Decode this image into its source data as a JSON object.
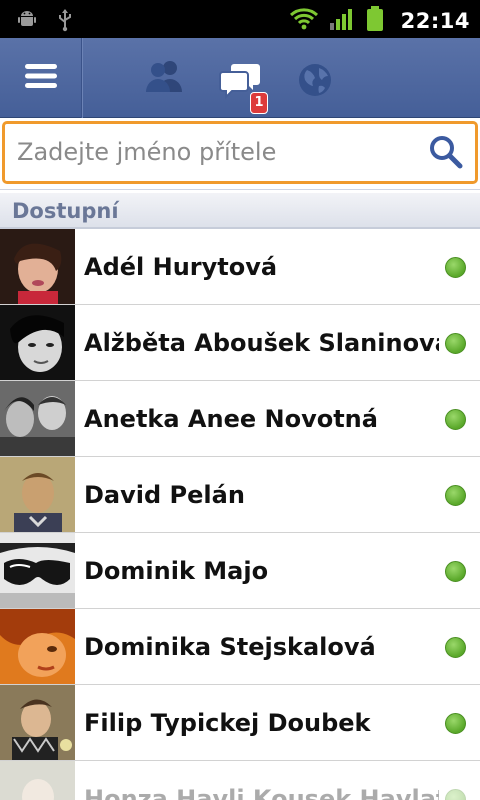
{
  "status_bar": {
    "time": "22:14",
    "icons": [
      "android-debug-icon",
      "usb-icon",
      "wifi-icon",
      "signal-icon",
      "battery-icon"
    ]
  },
  "navbar": {
    "menu_icon": "hamburger-menu-icon",
    "tabs": [
      {
        "icon": "friend-requests-icon"
      },
      {
        "icon": "messages-icon",
        "badge": "1"
      },
      {
        "icon": "notifications-globe-icon"
      }
    ]
  },
  "search": {
    "placeholder": "Zadejte jméno přítele",
    "value": ""
  },
  "section": {
    "title": "Dostupní"
  },
  "friends": [
    {
      "name": "Adél Hurytová",
      "online": true
    },
    {
      "name": "Alžběta Aboušek Slaninova",
      "online": true
    },
    {
      "name": "Anetka Anee Novotná",
      "online": true
    },
    {
      "name": "David Pelán",
      "online": true
    },
    {
      "name": "Dominik Majo",
      "online": true
    },
    {
      "name": "Dominika Stejskalová",
      "online": true
    },
    {
      "name": "Filip Typickej Doubek",
      "online": true
    },
    {
      "name": "Honza Havli Kousek Havlat",
      "online": true
    }
  ],
  "colors": {
    "navbar": "#455f98",
    "search_border": "#f09a2c",
    "online": "#5aa82a",
    "section_text": "#6a7797",
    "badge": "#dd3b3b"
  }
}
